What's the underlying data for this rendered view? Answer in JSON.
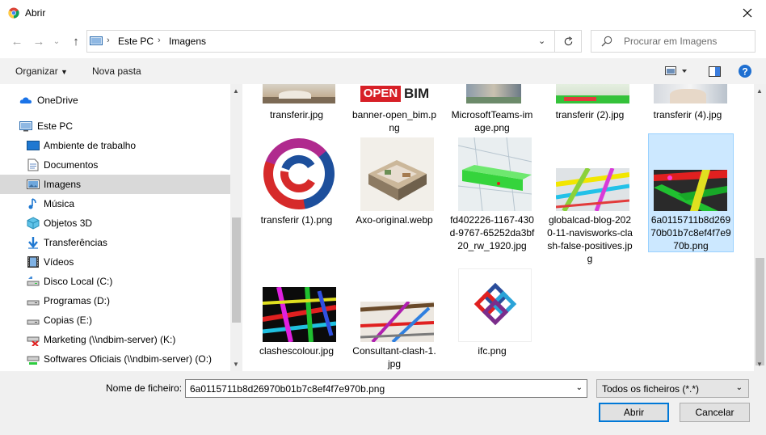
{
  "window": {
    "title": "Abrir"
  },
  "address": {
    "crumbs": [
      "Este PC",
      "Imagens"
    ],
    "search_placeholder": "Procurar em Imagens"
  },
  "toolbar": {
    "organize": "Organizar",
    "new_folder": "Nova pasta"
  },
  "sidebar": {
    "items": [
      {
        "label": "OneDrive"
      },
      {
        "label": "Este PC"
      },
      {
        "label": "Ambiente de trabalho"
      },
      {
        "label": "Documentos"
      },
      {
        "label": "Imagens"
      },
      {
        "label": "Música"
      },
      {
        "label": "Objetos 3D"
      },
      {
        "label": "Transferências"
      },
      {
        "label": "Vídeos"
      },
      {
        "label": "Disco Local (C:)"
      },
      {
        "label": "Programas (D:)"
      },
      {
        "label": "Copias (E:)"
      },
      {
        "label": "Marketing (\\\\ndbim-server) (K:)"
      },
      {
        "label": "Softwares Oficiais (\\\\ndbim-server) (O:)"
      }
    ]
  },
  "files": [
    {
      "name": "transferir.jpg"
    },
    {
      "name": "banner-open_bim.png"
    },
    {
      "name": "MicrosoftTeams-image.png"
    },
    {
      "name": "transferir (2).jpg"
    },
    {
      "name": "transferir (4).jpg"
    },
    {
      "name": "transferir (1).png"
    },
    {
      "name": "Axo-original.webp"
    },
    {
      "name": "fd402226-1167-430d-9767-65252da3bf20_rw_1920.jpg"
    },
    {
      "name": "globalcad-blog-2020-11-navisworks-clash-false-positives.jpg"
    },
    {
      "name": "6a0115711b8d26970b01b7c8ef4f7e970b.png"
    },
    {
      "name": "clashescolour.jpg"
    },
    {
      "name": "Consultant-clash-1.jpg"
    },
    {
      "name": "ifc.png"
    }
  ],
  "open_bim_text": {
    "open": "OPEN",
    "bim": "BIM"
  },
  "bottom": {
    "filename_label": "Nome de ficheiro:",
    "filename_value": "6a0115711b8d26970b01b7c8ef4f7e970b.png",
    "filter_value": "Todos os ficheiros (*.*)",
    "open_button": "Abrir",
    "cancel_button": "Cancelar"
  },
  "colors": {
    "accent": "#0078d7",
    "selected_bg": "#cce8ff",
    "sidebar_selected": "#d9d9d9"
  }
}
